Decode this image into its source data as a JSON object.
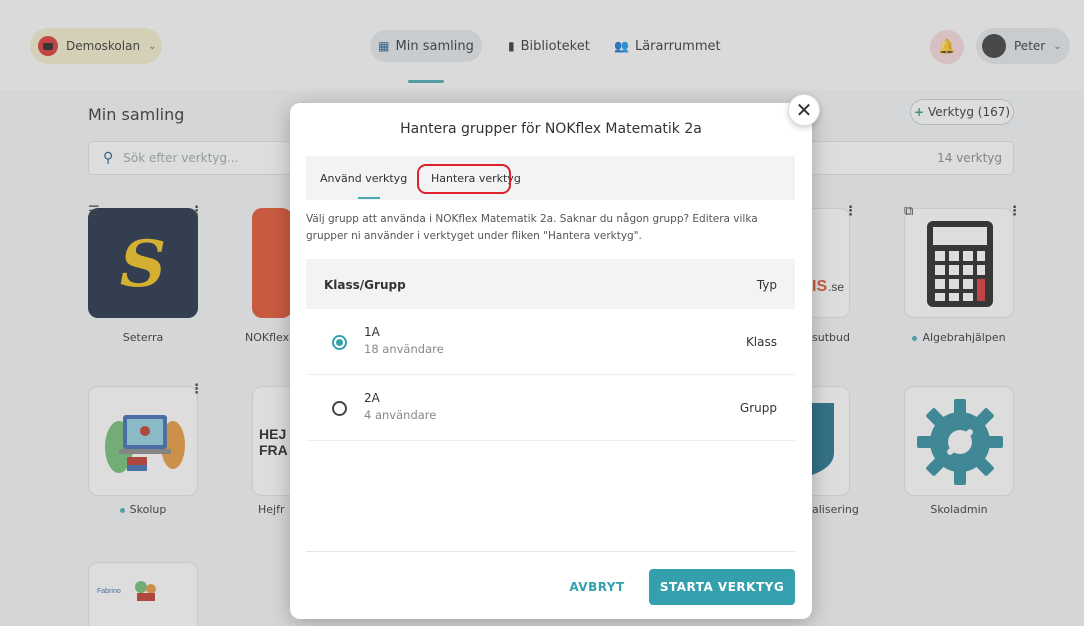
{
  "header": {
    "school": "Demoskolan",
    "nav": [
      {
        "label": "Min samling"
      },
      {
        "label": "Biblioteket"
      },
      {
        "label": "Lärarrummet"
      }
    ],
    "user": "Peter"
  },
  "collection": {
    "title": "Min samling",
    "add_button": "Verktyg (167)",
    "search_placeholder": "Sök efter verktyg...",
    "count": "14 verktyg",
    "tiles": [
      {
        "label": "Seterra"
      },
      {
        "label": "NOKflex"
      },
      {
        "label": "Algebrahjälpen"
      },
      {
        "label": "Skolup"
      },
      {
        "label": "Hejfr"
      },
      {
        "label": "Skoladmin"
      },
      {
        "label": "sutbud"
      },
      {
        "label": "alisering"
      }
    ]
  },
  "modal": {
    "title": "Hantera grupper för NOKflex Matematik 2a",
    "tabs": [
      "Använd verktyg",
      "Hantera verktyg"
    ],
    "info": "Välj grupp att använda i NOKflex Matematik 2a. Saknar du någon grupp? Editera vilka grupper ni använder i verktyget under fliken \"Hantera verktyg\".",
    "table": {
      "col_group": "Klass/Grupp",
      "col_type": "Typ",
      "rows": [
        {
          "name": "1A",
          "users": "18 användare",
          "type": "Klass",
          "selected": true
        },
        {
          "name": "2A",
          "users": "4 användare",
          "type": "Grupp",
          "selected": false
        }
      ]
    },
    "cancel": "AVBRYT",
    "start": "STARTA VERKTYG"
  },
  "colors": {
    "accent": "#35a0ad",
    "highlight": "#e0202a"
  }
}
